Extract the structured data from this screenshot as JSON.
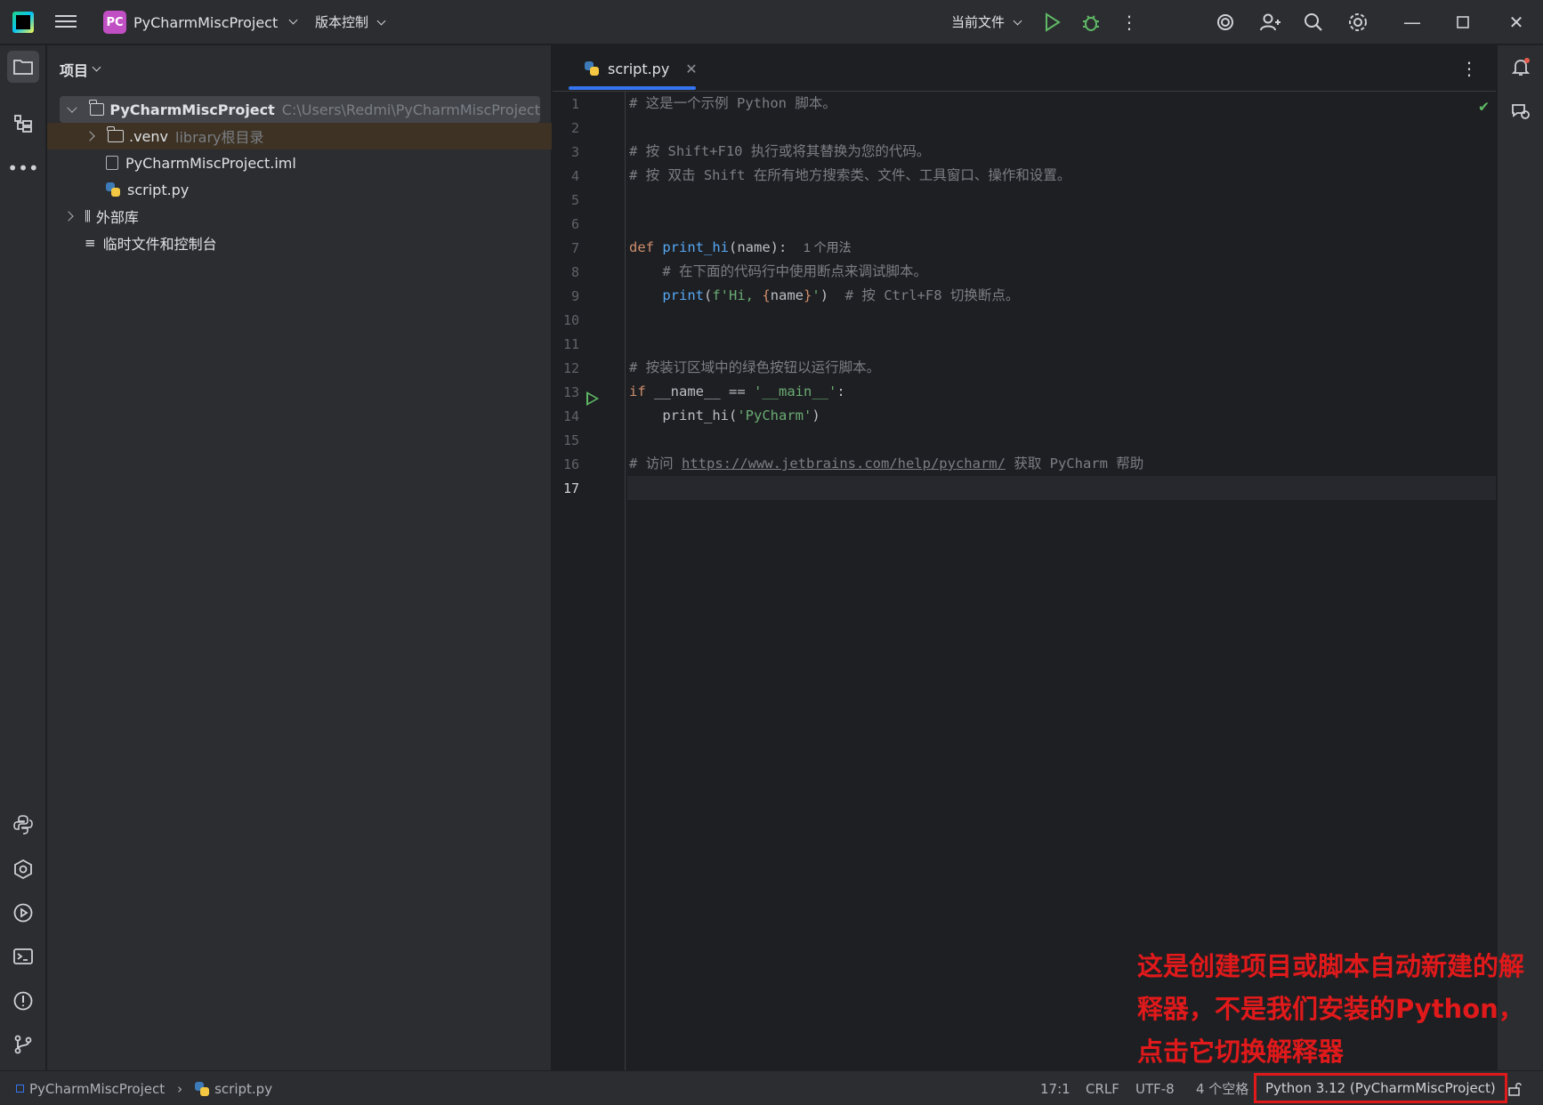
{
  "titlebar": {
    "project_badge": "PC",
    "project_name": "PyCharmMiscProject",
    "vcs_label": "版本控制",
    "run_config": "当前文件"
  },
  "project_panel": {
    "title": "项目",
    "tree": [
      {
        "name": "PyCharmMiscProject",
        "hint": "C:\\Users\\Redmi\\PyCharmMiscProject"
      },
      {
        "name": ".venv",
        "hint": "library根目录"
      },
      {
        "name": "PyCharmMiscProject.iml",
        "hint": ""
      },
      {
        "name": "script.py",
        "hint": ""
      },
      {
        "name": "外部库",
        "hint": ""
      },
      {
        "name": "临时文件和控制台",
        "hint": ""
      }
    ]
  },
  "editor": {
    "tab_name": "script.py",
    "current_line": 17,
    "line_numbers": [
      "1",
      "2",
      "3",
      "4",
      "5",
      "6",
      "7",
      "8",
      "9",
      "10",
      "11",
      "12",
      "13",
      "14",
      "15",
      "16",
      "17"
    ],
    "lines": {
      "l1": "# 这是一个示例 Python 脚本。",
      "l3": "# 按 Shift+F10 执行或将其替换为您的代码。",
      "l4": "# 按 双击 Shift 在所有地方搜索类、文件、工具窗口、操作和设置。",
      "l7_def": "def",
      "l7_fn": "print_hi",
      "l7_rest": "(name):",
      "l7_hint": "1 个用法",
      "l8": "# 在下面的代码行中使用断点来调试脚本。",
      "l9_fn": "print",
      "l9_open": "(",
      "l9_str1": "f'Hi, ",
      "l9_brace_open": "{",
      "l9_var": "name",
      "l9_brace_close": "}",
      "l9_str2": "'",
      "l9_close": ")",
      "l9_cmt": "# 按 Ctrl+F8 切换断点。",
      "l12": "# 按装订区域中的绿色按钮以运行脚本。",
      "l13_if": "if",
      "l13_rest": "__name__ ==",
      "l13_str": "'__main__'",
      "l13_colon": ":",
      "l14_call": "print_hi(",
      "l14_str": "'PyCharm'",
      "l14_close": ")",
      "l16_pre": "# 访问",
      "l16_link": "https://www.jetbrains.com/help/pycharm/",
      "l16_post": "获取 PyCharm 帮助"
    }
  },
  "annotation": "这是创建项目或脚本自动新建的解释器，不是我们安装的Python，点击它切换解释器",
  "status_bar": {
    "breadcrumb_project": "PyCharmMiscProject",
    "breadcrumb_file": "script.py",
    "position": "17:1",
    "line_sep": "CRLF",
    "encoding": "UTF-8",
    "indent": "4 个空格",
    "interpreter": "Python 3.12 (PyCharmMiscProject)"
  },
  "colors": {
    "accent": "#3574f0",
    "run_green": "#5fb865",
    "annotation_red": "#e0191b"
  }
}
